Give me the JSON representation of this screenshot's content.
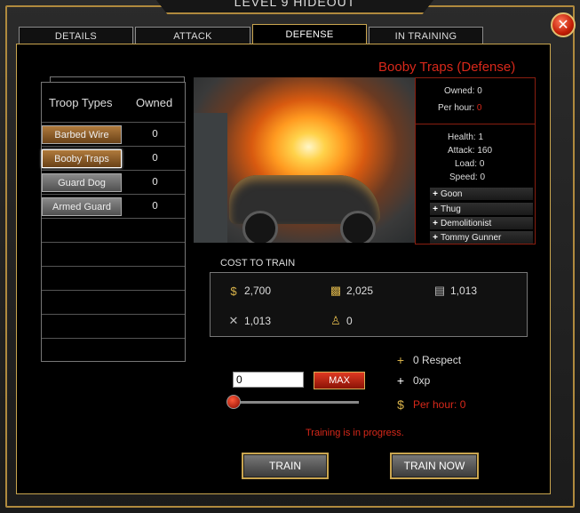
{
  "window": {
    "title": "LEVEL 9 HIDEOUT",
    "close_symbol": "✕"
  },
  "tabs": [
    {
      "label": "DETAILS",
      "active": false
    },
    {
      "label": "ATTACK",
      "active": false
    },
    {
      "label": "DEFENSE",
      "active": true
    },
    {
      "label": "IN TRAINING",
      "active": false
    }
  ],
  "troops": {
    "header_type": "Troop Types",
    "header_owned": "Owned",
    "items": [
      {
        "name": "Barbed Wire",
        "owned": "0"
      },
      {
        "name": "Booby Traps",
        "owned": "0"
      },
      {
        "name": "Guard Dog",
        "owned": "0"
      },
      {
        "name": "Armed Guard",
        "owned": "0"
      }
    ]
  },
  "unit": {
    "title": "Booby Traps (Defense)",
    "owned_label": "Owned:",
    "owned_value": "0",
    "per_hour_label": "Per hour:",
    "per_hour_value": "0",
    "health_label": "Health:",
    "health_value": "1",
    "attack_label": "Attack:",
    "attack_value": "160",
    "load_label": "Load:",
    "load_value": "0",
    "speed_label": "Speed:",
    "speed_value": "0",
    "upgrades": [
      "Goon",
      "Thug",
      "Demolitionist",
      "Tommy Gunner"
    ]
  },
  "cost": {
    "label": "COST TO TRAIN",
    "money": "2,700",
    "crates": "2,025",
    "ammo": "1,013",
    "tools": "1,013",
    "manpower": "0"
  },
  "train": {
    "quantity_value": "0",
    "max_label": "MAX",
    "respect": "0 Respect",
    "xp": "0xp",
    "per_hour": "Per hour: 0",
    "status": "Training is in progress.",
    "train_label": "TRAIN",
    "train_now_label": "TRAIN NOW"
  },
  "colors": {
    "accent_gold": "#c9a54f",
    "alert_red": "#d8281a"
  }
}
